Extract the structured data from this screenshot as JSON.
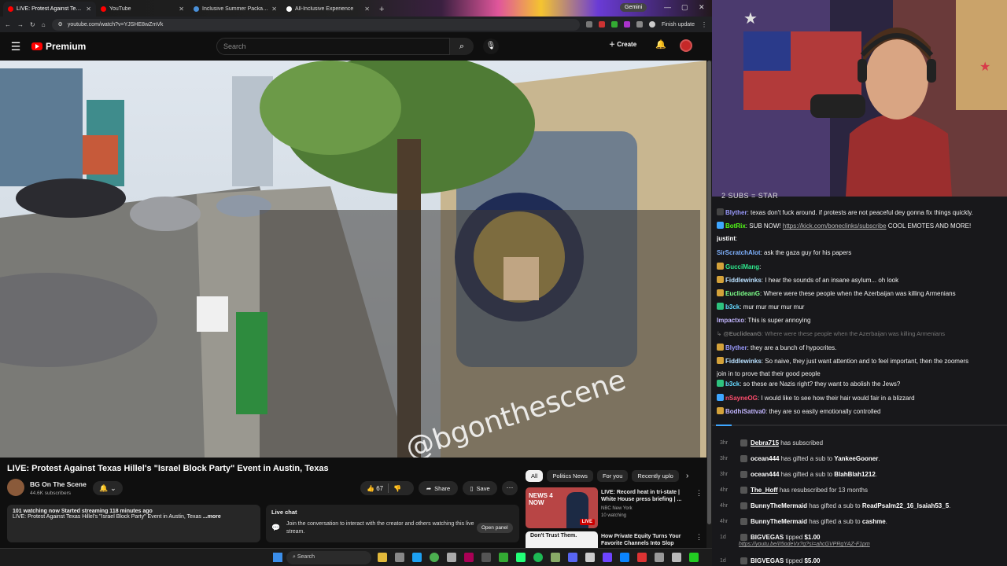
{
  "browser": {
    "tabs": [
      {
        "title": "LIVE: Protest Against Texas Hill",
        "active": true,
        "color": "#ff0000"
      },
      {
        "title": "YouTube",
        "active": false,
        "color": "#ff0000"
      },
      {
        "title": "Inclusive Summer Package | Co",
        "active": false,
        "color": "#4a90d9"
      },
      {
        "title": "All-Inclusive Experience",
        "active": false,
        "color": "#ffffff"
      }
    ],
    "new_tab": "+",
    "gemini_label": "Gemini",
    "url": "youtube.com/watch?v=YJSHE8wZmVk",
    "finish_update": "Finish update"
  },
  "youtube": {
    "logo_text": "Premium",
    "search_placeholder": "Search",
    "create_label": "Create",
    "video": {
      "watermark": "@bgonthescene",
      "title": "LIVE: Protest Against Texas Hillel's \"Israel Block Party\" Event in Austin, Texas",
      "channel": "BG On The Scene",
      "subscribers": "44.6K subscribers",
      "likes": "67",
      "share_label": "Share",
      "save_label": "Save",
      "description_stats": "101 watching now  Started streaming 118 minutes ago",
      "description_text": "LIVE: Protest Against Texas Hillel's \"Israel Block Party\" Event in Austin, Texas ",
      "description_more": "...more"
    },
    "live_chat": {
      "title": "Live chat",
      "body": "Join the conversation to interact with the creator and others watching this live stream.",
      "open_label": "Open panel"
    },
    "chips": [
      "All",
      "Politics News",
      "For you",
      "Recently uplo"
    ],
    "recommendations": [
      {
        "title": "LIVE: Record heat in tri-state | White House press briefing | ...",
        "channel": "NBC New York",
        "watching": "10 watching",
        "thumb_text": "NEWS 4 NOW",
        "live": "LIVE"
      },
      {
        "title": "How Private Equity Turns Your Favorite Channels Into Slop",
        "channel": "",
        "watching": "",
        "thumb_text": "Don't Trust Them.",
        "live": ""
      }
    ]
  },
  "taskbar": {
    "search_placeholder": "Search"
  },
  "stream_chat": {
    "header": "2 SUBS = STAR",
    "messages": [
      {
        "user": "Blyther",
        "color": "#9b9bff",
        "text": ": texas don't fuck around. if protests are not peaceful dey gonna fix things quickly.",
        "badge": "#444"
      },
      {
        "user": "BotRix",
        "color": "#53fc18",
        "text": ": SUB NOW! ",
        "link": "https://kick.com/boneclinks/subscribe",
        "text2": " COOL EMOTES AND MORE!",
        "badge": "#3ea6ff"
      },
      {
        "user": "justint",
        "color": "#ffffff",
        "text": ":",
        "badge": ""
      },
      {
        "user": "SirScratchAlot",
        "color": "#7fb2ff",
        "text": ": ask the gaza guy for his papers",
        "badge": ""
      },
      {
        "user": "GucciMang",
        "color": "#2ee88d",
        "text": ":",
        "badge": "#d4a23a"
      },
      {
        "user": "Fiddlewinks",
        "color": "#b9e0ff",
        "text": ": I hear the sounds of an insane asylum... oh look",
        "badge": "#d4a23a"
      },
      {
        "user": "EuclideanG",
        "color": "#7dff8a",
        "text": ": Where were these people when the Azerbaijan was killing Armenians",
        "badge": "#d4a23a"
      },
      {
        "user": "b3ck",
        "color": "#66d9ff",
        "text": ": mur mur mur mur mur",
        "badge": "#2ec27e"
      },
      {
        "user": "Impactxo",
        "color": "#c3b6ff",
        "text": ": This is super annoying",
        "badge": ""
      },
      {
        "user": "@EuclideanG",
        "color": "#777777",
        "text": ": Where were these people when the Azerbaijan was killing Armenians",
        "reply": true
      },
      {
        "user": "Blyther",
        "color": "#9b9bff",
        "text": ": they are a bunch of hypocrites.",
        "badge": "#d4a23a"
      },
      {
        "user": "Fiddlewinks",
        "color": "#b9e0ff",
        "text": ": So naive, they just want attention and to feel important, then the zoomers",
        "badge": "#d4a23a"
      },
      {
        "user": "",
        "color": "#dddddd",
        "text": "join in to prove that their good people",
        "cont": true
      },
      {
        "user": "b3ck",
        "color": "#66d9ff",
        "text": ": so these are Nazis right? they want to abolish the Jews?",
        "badge": "#2ec27e"
      },
      {
        "user": "nSayneOG",
        "color": "#ff4d6d",
        "text": ": I would like to see how their hair would fair in a blizzard",
        "badge": "#3ea6ff"
      },
      {
        "user": "BodhiSattva0",
        "color": "#c3b6ff",
        "text": ": they are so easily emotionally controlled",
        "badge": "#d4a23a"
      }
    ],
    "events": [
      {
        "time": "3hr",
        "parts": [
          {
            "t": "Debra715",
            "u": true
          },
          {
            "t": " has subscribed"
          }
        ]
      },
      {
        "time": "3hr",
        "parts": [
          {
            "t": "ocean444",
            "b": true
          },
          {
            "t": " has gifted a sub to "
          },
          {
            "t": "YankeeGooner",
            "b": true
          },
          {
            "t": "."
          }
        ]
      },
      {
        "time": "3hr",
        "parts": [
          {
            "t": "ocean444",
            "b": true
          },
          {
            "t": " has gifted a sub to "
          },
          {
            "t": "BlahBlah1212",
            "b": true
          },
          {
            "t": "."
          }
        ]
      },
      {
        "time": "4hr",
        "parts": [
          {
            "t": "The_Hoff",
            "u": true
          },
          {
            "t": " has resubscribed for 13 months"
          }
        ]
      },
      {
        "time": "4hr",
        "parts": [
          {
            "t": "BunnyTheMermaid",
            "b": true
          },
          {
            "t": " has gifted a sub to "
          },
          {
            "t": "ReadPsalm22_16_Isaiah53_5",
            "b": true
          },
          {
            "t": "."
          }
        ]
      },
      {
        "time": "4hr",
        "parts": [
          {
            "t": "BunnyTheMermaid",
            "b": true
          },
          {
            "t": " has gifted a sub to "
          },
          {
            "t": "cashme",
            "b": true
          },
          {
            "t": "."
          }
        ]
      },
      {
        "time": "1d",
        "parts": [
          {
            "t": "BIGVEGAS",
            "b": true
          },
          {
            "t": " tipped "
          },
          {
            "t": "$1.00",
            "b": true
          }
        ],
        "link": "https://youtu.be/II5odeVx?g?si=ahcGVPRgYAZ-F1pm"
      },
      {
        "time": "1d",
        "parts": [
          {
            "t": "BIGVEGAS",
            "b": true
          },
          {
            "t": " tipped "
          },
          {
            "t": "$5.00",
            "b": true
          }
        ]
      }
    ]
  }
}
